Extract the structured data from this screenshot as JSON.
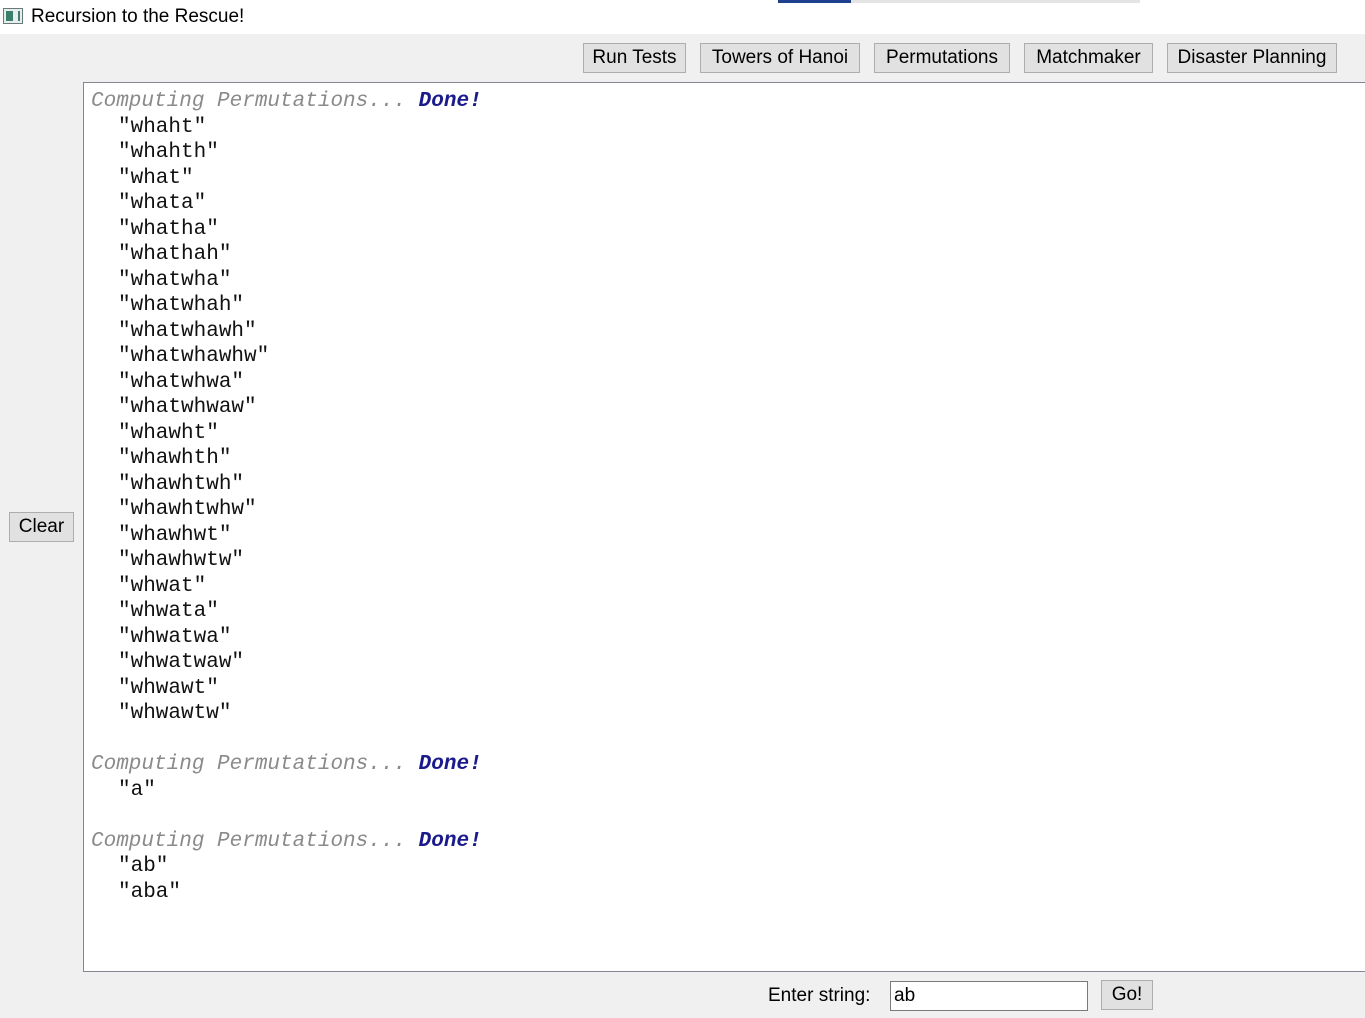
{
  "window": {
    "title": "Recursion to the Rescue!"
  },
  "toolbar": {
    "buttons": [
      {
        "label": "Run Tests"
      },
      {
        "label": "Towers of Hanoi"
      },
      {
        "label": "Permutations"
      },
      {
        "label": "Matchmaker"
      },
      {
        "label": "Disaster Planning"
      }
    ]
  },
  "sidebar": {
    "clear_label": "Clear"
  },
  "console": {
    "computing_text": "Computing Permutations...",
    "done_text": "Done!",
    "blocks": [
      {
        "results": [
          "\"whaht\"",
          "\"whahth\"",
          "\"what\"",
          "\"whata\"",
          "\"whatha\"",
          "\"whathah\"",
          "\"whatwha\"",
          "\"whatwhah\"",
          "\"whatwhawh\"",
          "\"whatwhawhw\"",
          "\"whatwhwa\"",
          "\"whatwhwaw\"",
          "\"whawht\"",
          "\"whawhth\"",
          "\"whawhtwh\"",
          "\"whawhtwhw\"",
          "\"whawhwt\"",
          "\"whawhwtw\"",
          "\"whwat\"",
          "\"whwata\"",
          "\"whwatwa\"",
          "\"whwatwaw\"",
          "\"whwawt\"",
          "\"whwawtw\""
        ]
      },
      {
        "results": [
          "\"a\""
        ]
      },
      {
        "results": [
          "\"ab\"",
          "\"aba\""
        ]
      }
    ]
  },
  "input": {
    "label": "Enter string:",
    "value": "ab",
    "go_label": "Go!"
  },
  "colors": {
    "computing": "#8a8a8a",
    "done": "#1a1a8c",
    "tab_active": "#1f3f8f"
  }
}
